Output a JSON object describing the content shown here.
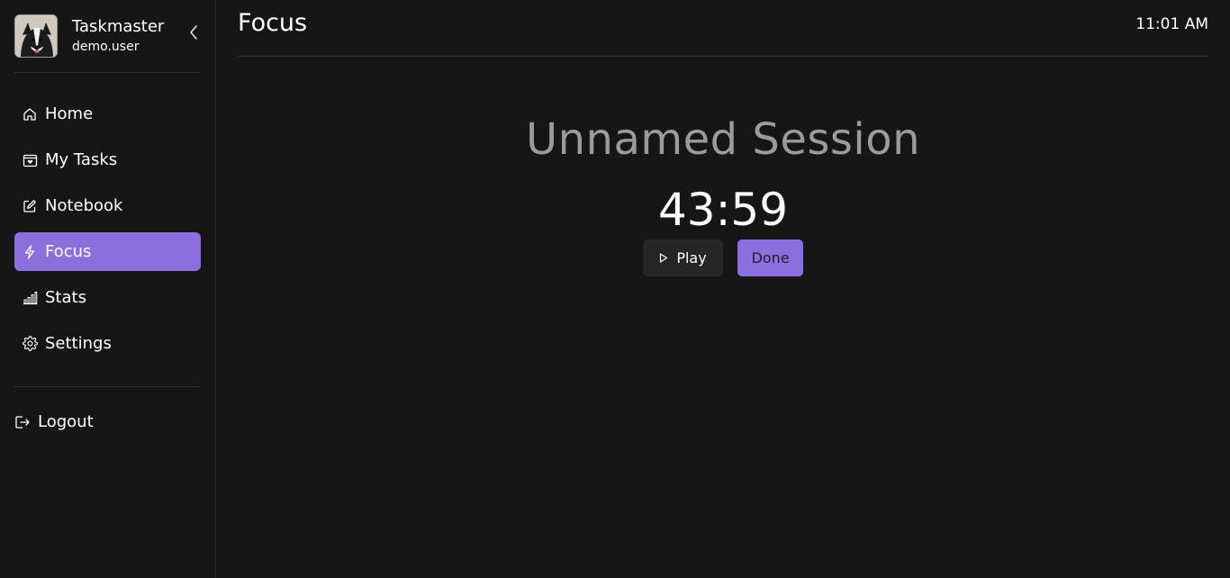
{
  "profile": {
    "app_name": "Taskmaster",
    "username": "demo.user"
  },
  "nav": {
    "items": [
      {
        "label": "Home",
        "icon": "home-icon"
      },
      {
        "label": "My Tasks",
        "icon": "calendar-icon"
      },
      {
        "label": "Notebook",
        "icon": "edit-icon"
      },
      {
        "label": "Focus",
        "icon": "lightning-icon",
        "active": true
      },
      {
        "label": "Stats",
        "icon": "bar-chart-icon"
      },
      {
        "label": "Settings",
        "icon": "gear-icon"
      }
    ],
    "logout_label": "Logout"
  },
  "header": {
    "title": "Focus",
    "time": "11:01 AM"
  },
  "session": {
    "name": "Unnamed Session",
    "timer": "43:59",
    "play_label": "Play",
    "done_label": "Done"
  },
  "colors": {
    "accent": "#8b6fdc",
    "background": "#161616",
    "muted_text": "#9b9b9b"
  }
}
